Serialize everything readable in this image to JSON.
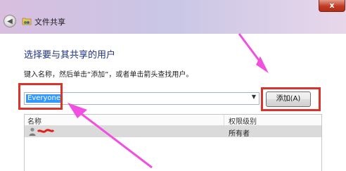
{
  "window": {
    "title": "文件共享",
    "back_icon": "back-arrow-icon",
    "close_label": "x"
  },
  "dialog": {
    "heading": "选择要与其共享的用户",
    "instruction": "键入名称，然后单击“添加”，或者单击箭头查找用户。",
    "combo_value": "Everyone",
    "add_button_label": "添加(A)"
  },
  "list": {
    "columns": [
      "名称",
      "权限级别"
    ],
    "rows": [
      {
        "name_redacted": true,
        "permission": "所有者"
      }
    ]
  },
  "annotations": {
    "highlight_color": "#d9342b",
    "arrow_color": "#f050e0"
  }
}
